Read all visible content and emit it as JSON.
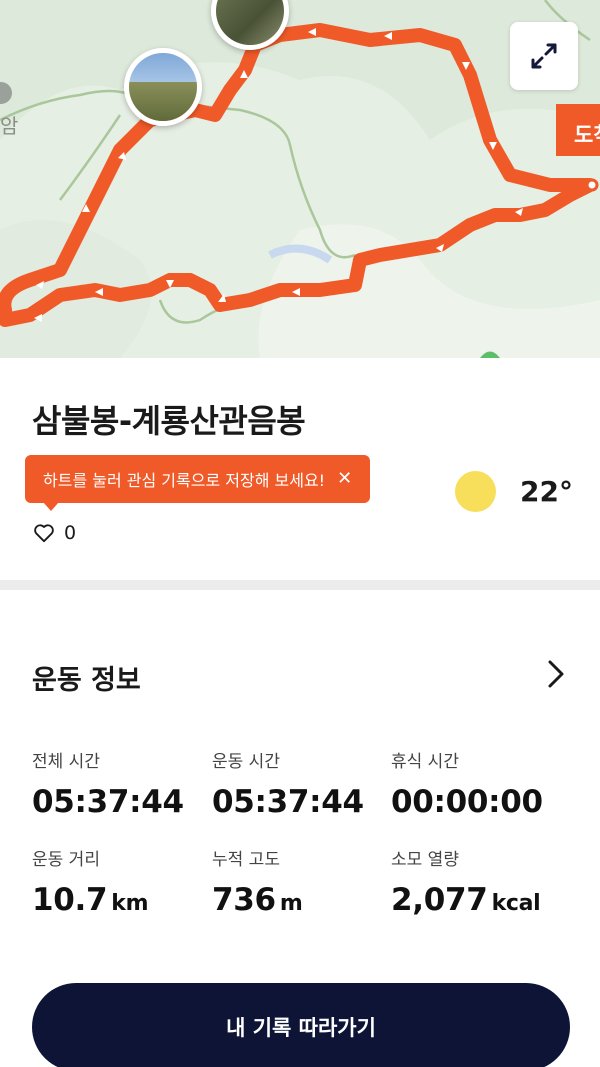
{
  "map": {
    "place_label": "암",
    "arrival_label": "도착",
    "expand_icon": "expand-arrows-icon",
    "photo_markers": [
      "mountain-photo",
      "forest-photo"
    ],
    "route_color": "#f05a28",
    "bg_color": "#e6efe4"
  },
  "record": {
    "title": "삼불봉-계룡산관음봉",
    "tooltip_text": "하트를 눌러 관심 기록으로 저장해 보세요!",
    "tooltip_close": "✕",
    "like_count": "0",
    "temperature": "22°",
    "weather_icon": "sun-icon"
  },
  "stats": {
    "header": "운동 정보",
    "items": [
      {
        "label": "전체 시간",
        "value": "05:37:44",
        "unit": ""
      },
      {
        "label": "운동 시간",
        "value": "05:37:44",
        "unit": ""
      },
      {
        "label": "휴식 시간",
        "value": "00:00:00",
        "unit": ""
      },
      {
        "label": "운동 거리",
        "value": "10.7",
        "unit": "km"
      },
      {
        "label": "누적 고도",
        "value": "736",
        "unit": "m"
      },
      {
        "label": "소모 열량",
        "value": "2,077",
        "unit": "kcal"
      }
    ]
  },
  "actions": {
    "follow_label": "내 기록 따라가기"
  },
  "colors": {
    "accent": "#f05a28",
    "button_bg": "#0d1436",
    "sun": "#f7df5c"
  }
}
